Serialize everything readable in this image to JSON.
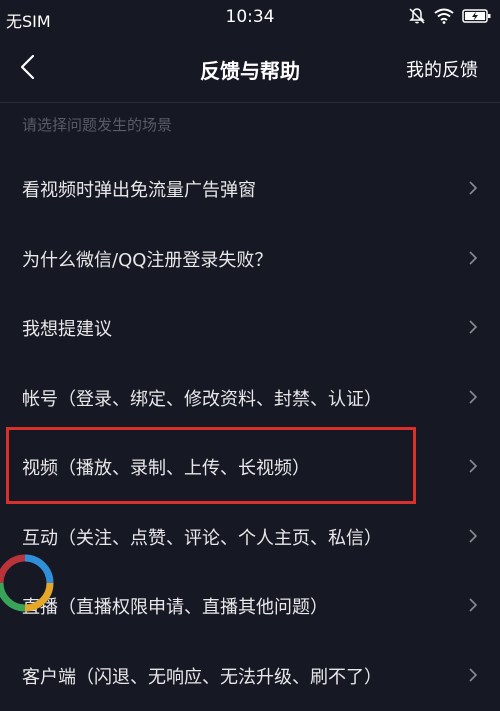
{
  "status_bar": {
    "carrier": "无SIM",
    "time": "10:34",
    "icons": [
      "mute-icon",
      "wifi-icon",
      "battery-charging-icon"
    ]
  },
  "nav": {
    "title": "反馈与帮助",
    "action": "我的反馈",
    "back_icon": "chevron-left-icon"
  },
  "section_hint": "请选择问题发生的场景",
  "items": [
    {
      "label": "看视频时弹出免流量广告弹窗"
    },
    {
      "label": "为什么微信/QQ注册登录失败？"
    },
    {
      "label": "我想提建议"
    },
    {
      "label": "帐号（登录、绑定、修改资料、封禁、认证）"
    },
    {
      "label": "视频（播放、录制、上传、长视频）"
    },
    {
      "label": "互动（关注、点赞、评论、个人主页、私信）"
    },
    {
      "label": "直播（直播权限申请、直播其他问题）"
    },
    {
      "label": "客户端（闪退、无响应、无法升级、刷不了）"
    }
  ],
  "colors": {
    "background": "#161823",
    "highlight": "#d9302b",
    "hint_text": "#595b66"
  }
}
